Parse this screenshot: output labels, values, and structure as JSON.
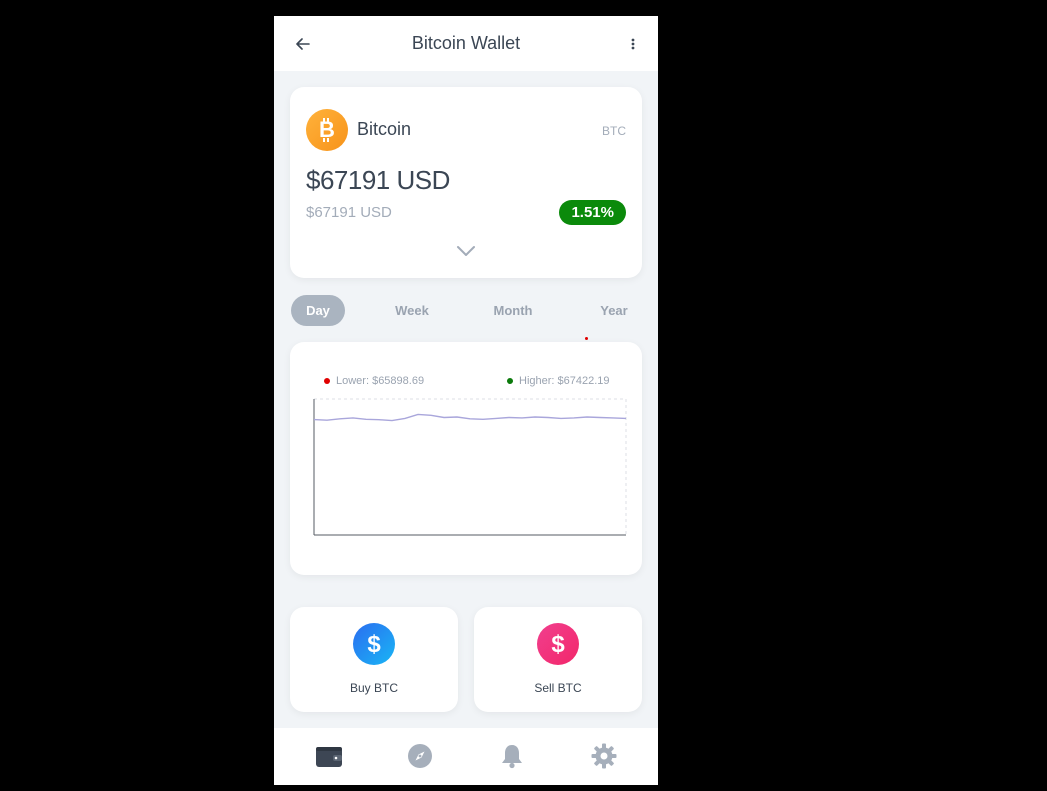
{
  "header": {
    "title": "Bitcoin Wallet",
    "back_icon": "arrow-left-icon",
    "more_icon": "more-vertical-icon"
  },
  "coin": {
    "name": "Bitcoin",
    "symbol": "BTC",
    "logo_icon": "bitcoin-icon",
    "price": "$67191 USD",
    "price_secondary": "$67191 USD",
    "change": "1.51%",
    "expand_icon": "chevron-down-icon"
  },
  "periods": {
    "tabs": [
      {
        "label": "Day",
        "active": true
      },
      {
        "label": "Week",
        "active": false
      },
      {
        "label": "Month",
        "active": false
      },
      {
        "label": "Year",
        "active": false
      }
    ]
  },
  "chart": {
    "lower_label": "Lower: $65898.69",
    "higher_label": "Higher: $67422.19"
  },
  "chart_data": {
    "type": "line",
    "series": [
      {
        "values": [
          67191,
          67185,
          67200,
          67210,
          67195,
          67190,
          67180,
          67205,
          67250,
          67240,
          67215,
          67220,
          67200,
          67195,
          67205,
          67215,
          67210,
          67220,
          67215,
          67205,
          67210,
          67220,
          67215,
          67210,
          67205
        ]
      }
    ],
    "ylim": [
      65898.69,
      67422.19
    ],
    "grid": false
  },
  "actions": {
    "buy_label": "Buy BTC",
    "sell_label": "Sell BTC",
    "buy_icon": "dollar-icon",
    "sell_icon": "dollar-icon"
  },
  "nav": {
    "items": [
      "wallet-icon",
      "compass-icon",
      "bell-icon",
      "gear-icon"
    ]
  },
  "colors": {
    "accent_green": "#0b8a0b",
    "bitcoin_orange": "#f7931a",
    "buy_blue": "#1a9bf0",
    "sell_pink": "#f0367a",
    "line": "#a9a6db",
    "lower_dot": "#e00000",
    "higher_dot": "#0b7a0b"
  }
}
